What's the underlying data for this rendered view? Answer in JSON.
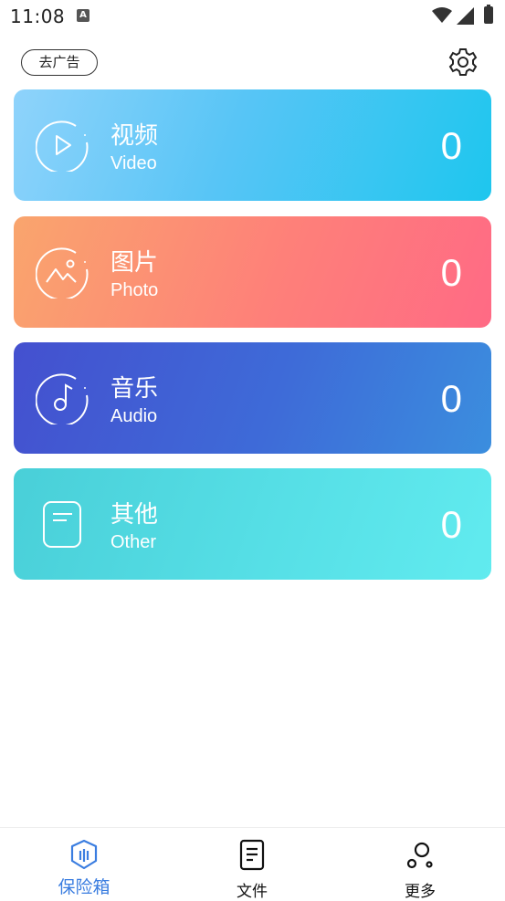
{
  "status_bar": {
    "time": "11:08",
    "notification_icon_letter": "A"
  },
  "header": {
    "remove_ads_label": "去广告",
    "settings_icon": "gear-icon"
  },
  "cards": [
    {
      "title": "视频",
      "subtitle": "Video",
      "count": "0",
      "icon": "video-icon"
    },
    {
      "title": "图片",
      "subtitle": "Photo",
      "count": "0",
      "icon": "photo-icon"
    },
    {
      "title": "音乐",
      "subtitle": "Audio",
      "count": "0",
      "icon": "audio-icon"
    },
    {
      "title": "其他",
      "subtitle": "Other",
      "count": "0",
      "icon": "document-icon"
    }
  ],
  "bottom_nav": [
    {
      "label": "保险箱",
      "icon": "safe-shield-icon",
      "active": true
    },
    {
      "label": "文件",
      "icon": "file-icon",
      "active": false
    },
    {
      "label": "更多",
      "icon": "more-icon",
      "active": false
    }
  ],
  "colors": {
    "accent": "#3a7de0",
    "video": "#58c5f6",
    "photo": "#fe8079",
    "audio": "#3e6bd8",
    "other": "#56dfe6"
  }
}
